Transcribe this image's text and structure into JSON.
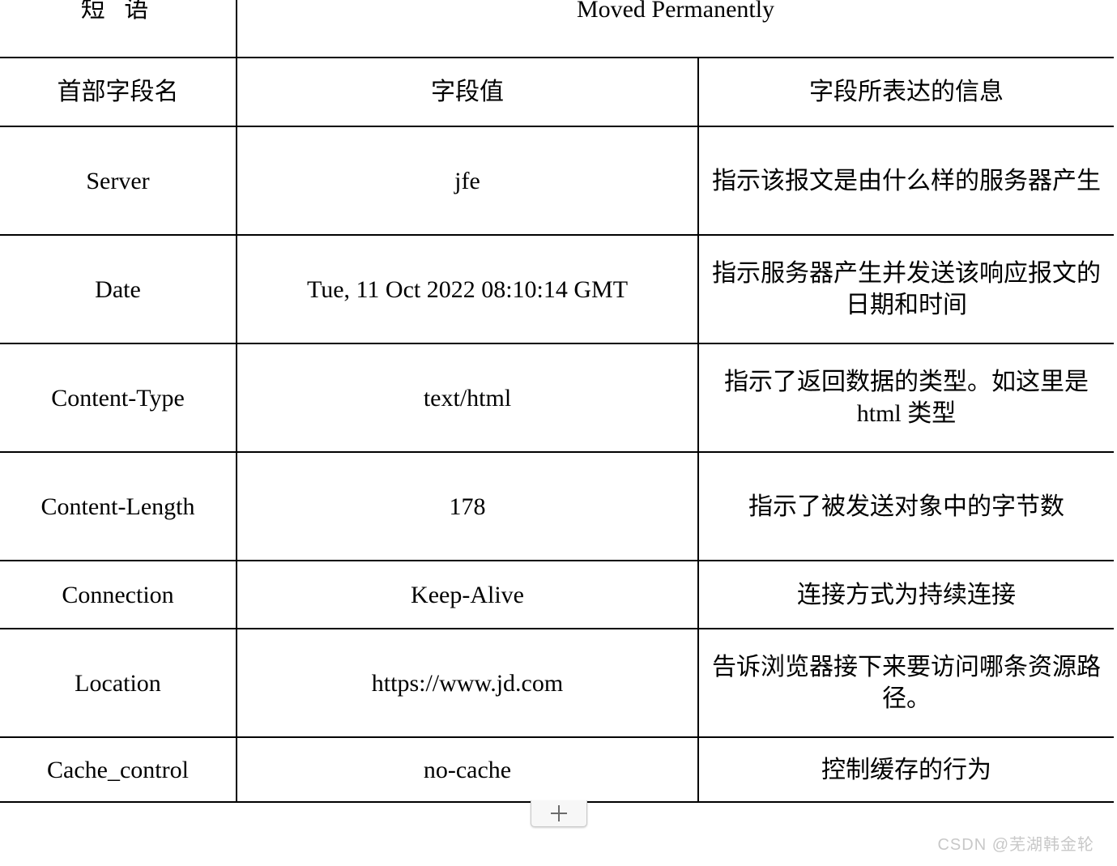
{
  "document": {
    "title_row": {
      "label": "短 语",
      "value": "Moved Permanently"
    },
    "columns": [
      "首部字段名",
      "字段值",
      "字段所表达的信息"
    ],
    "rows": [
      {
        "field": "Server",
        "value": "jfe",
        "description": "指示该报文是由什么样的服务器产生"
      },
      {
        "field": "Date",
        "value": "Tue, 11 Oct 2022 08:10:14 GMT",
        "description": "指示服务器产生并发送该响应报文的日期和时间"
      },
      {
        "field": "Content-Type",
        "value": "text/html",
        "description": "指示了返回数据的类型。如这里是 html 类型"
      },
      {
        "field": "Content-Length",
        "value": "178",
        "description": "指示了被发送对象中的字节数"
      },
      {
        "field": "Connection",
        "value": "Keep-Alive",
        "description": "连接方式为持续连接"
      },
      {
        "field": "Location",
        "value": "https://www.jd.com",
        "description": "告诉浏览器接下来要访问哪条资源路径。"
      },
      {
        "field": "Cache_control",
        "value": "no-cache",
        "description": "控制缓存的行为"
      }
    ]
  },
  "controls": {
    "add_row_button": {
      "icon": "plus-icon",
      "label": "+"
    }
  },
  "watermark": {
    "text": "CSDN @芜湖韩金轮",
    "color": "#c8c8c8"
  }
}
